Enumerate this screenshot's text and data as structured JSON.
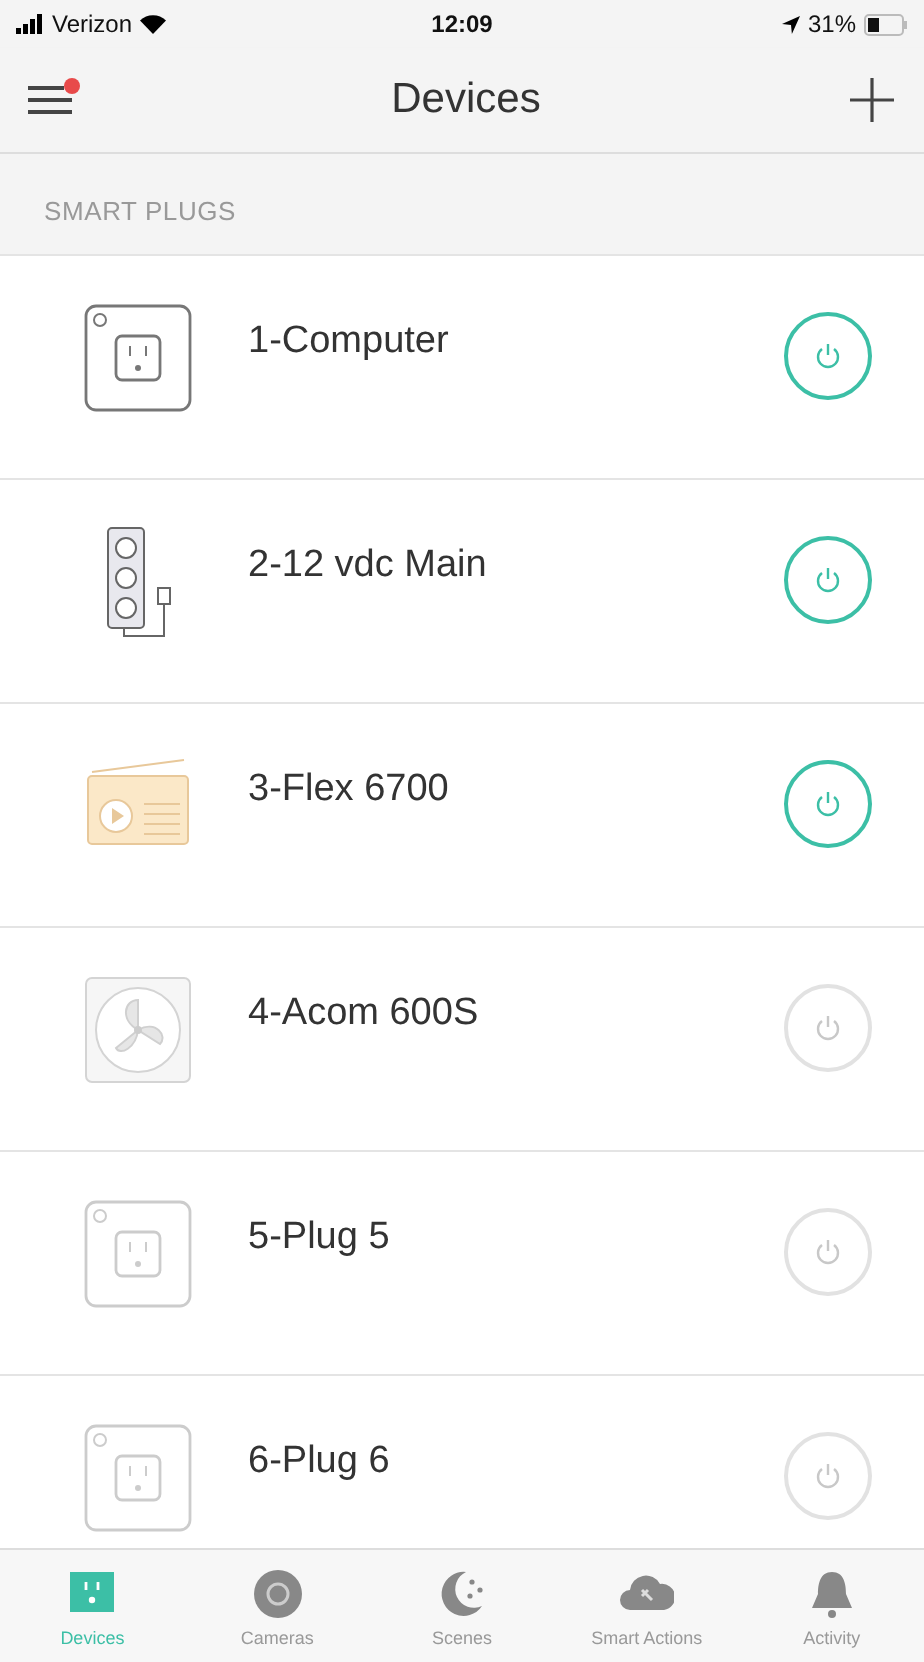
{
  "status_bar": {
    "carrier": "Verizon",
    "time": "12:09",
    "battery": "31%"
  },
  "header": {
    "title": "Devices",
    "menu_notification": true
  },
  "section": {
    "title": "SMART PLUGS"
  },
  "devices": [
    {
      "name": "1-Computer",
      "kind": "plug",
      "on": true
    },
    {
      "name": "2-12 vdc Main",
      "kind": "strip",
      "on": true
    },
    {
      "name": "3-Flex 6700",
      "kind": "radio",
      "on": true
    },
    {
      "name": "4-Acom 600S",
      "kind": "fan",
      "on": false
    },
    {
      "name": "5-Plug 5",
      "kind": "plug",
      "on": false
    },
    {
      "name": "6-Plug 6",
      "kind": "plug",
      "on": false
    }
  ],
  "tabs": [
    {
      "label": "Devices",
      "kind": "devices",
      "selected": true
    },
    {
      "label": "Cameras",
      "kind": "camera",
      "selected": false
    },
    {
      "label": "Scenes",
      "kind": "scenes",
      "selected": false
    },
    {
      "label": "Smart Actions",
      "kind": "actions",
      "selected": false
    },
    {
      "label": "Activity",
      "kind": "activity",
      "selected": false
    }
  ]
}
